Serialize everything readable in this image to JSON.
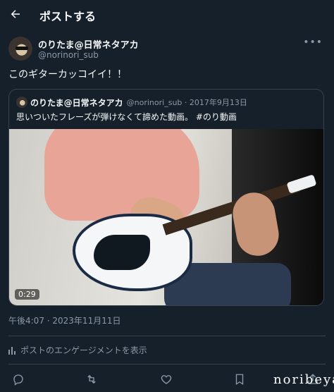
{
  "header": {
    "title": "ポストする",
    "back_icon": "arrow-left-icon"
  },
  "author": {
    "name": "のりたま@日常ネタアカ",
    "handle": "@norinori_sub",
    "more_icon": "more-horizontal-icon"
  },
  "tweet": {
    "text": "このギターカッコイイ！！"
  },
  "quote": {
    "name": "のりたま@日常ネタアカ",
    "meta": "@norinori_sub · 2017年9月13日",
    "text": "思いついたフレーズが弾けなくて諦めた動画。 #のり動画",
    "video_duration": "0:29"
  },
  "timestamp": "午後4:07 · 2023年11月11日",
  "engagement": {
    "label": "ポストのエンゲージメントを表示",
    "icon": "bar-chart-icon"
  },
  "actions": [
    "reply-icon",
    "retweet-icon",
    "like-icon",
    "bookmark-icon",
    "share-icon"
  ],
  "watermark": "noribeya",
  "colors": {
    "background": "#15202b",
    "text": "#f7f9f9",
    "muted": "#8b98a5",
    "border": "#38444d"
  }
}
